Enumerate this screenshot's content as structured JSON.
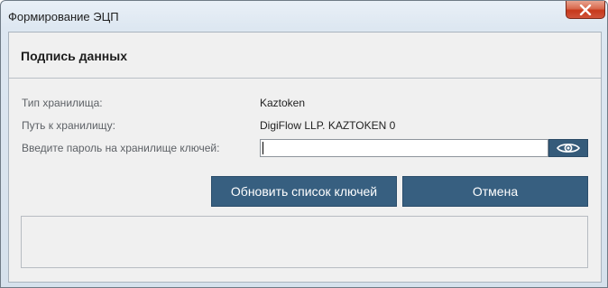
{
  "window": {
    "title": "Формирование ЭЦП",
    "close_icon": "close-icon"
  },
  "dialog": {
    "heading": "Подпись данных",
    "fields": {
      "storage_type_label": "Тип хранилища:",
      "storage_type_value": "Kaztoken",
      "storage_path_label": "Путь к хранилищу:",
      "storage_path_value": "DigiFlow LLP. KAZTOKEN 0",
      "password_label": "Введите пароль на хранилище ключей:",
      "password_value": "",
      "eye_icon": "eye-icon"
    },
    "buttons": {
      "refresh_label": "Обновить список ключей",
      "cancel_label": "Отмена"
    },
    "message_text": ""
  },
  "colors": {
    "button_bg": "#375f80",
    "button_text": "#ffffff",
    "close_red": "#c7381b"
  }
}
